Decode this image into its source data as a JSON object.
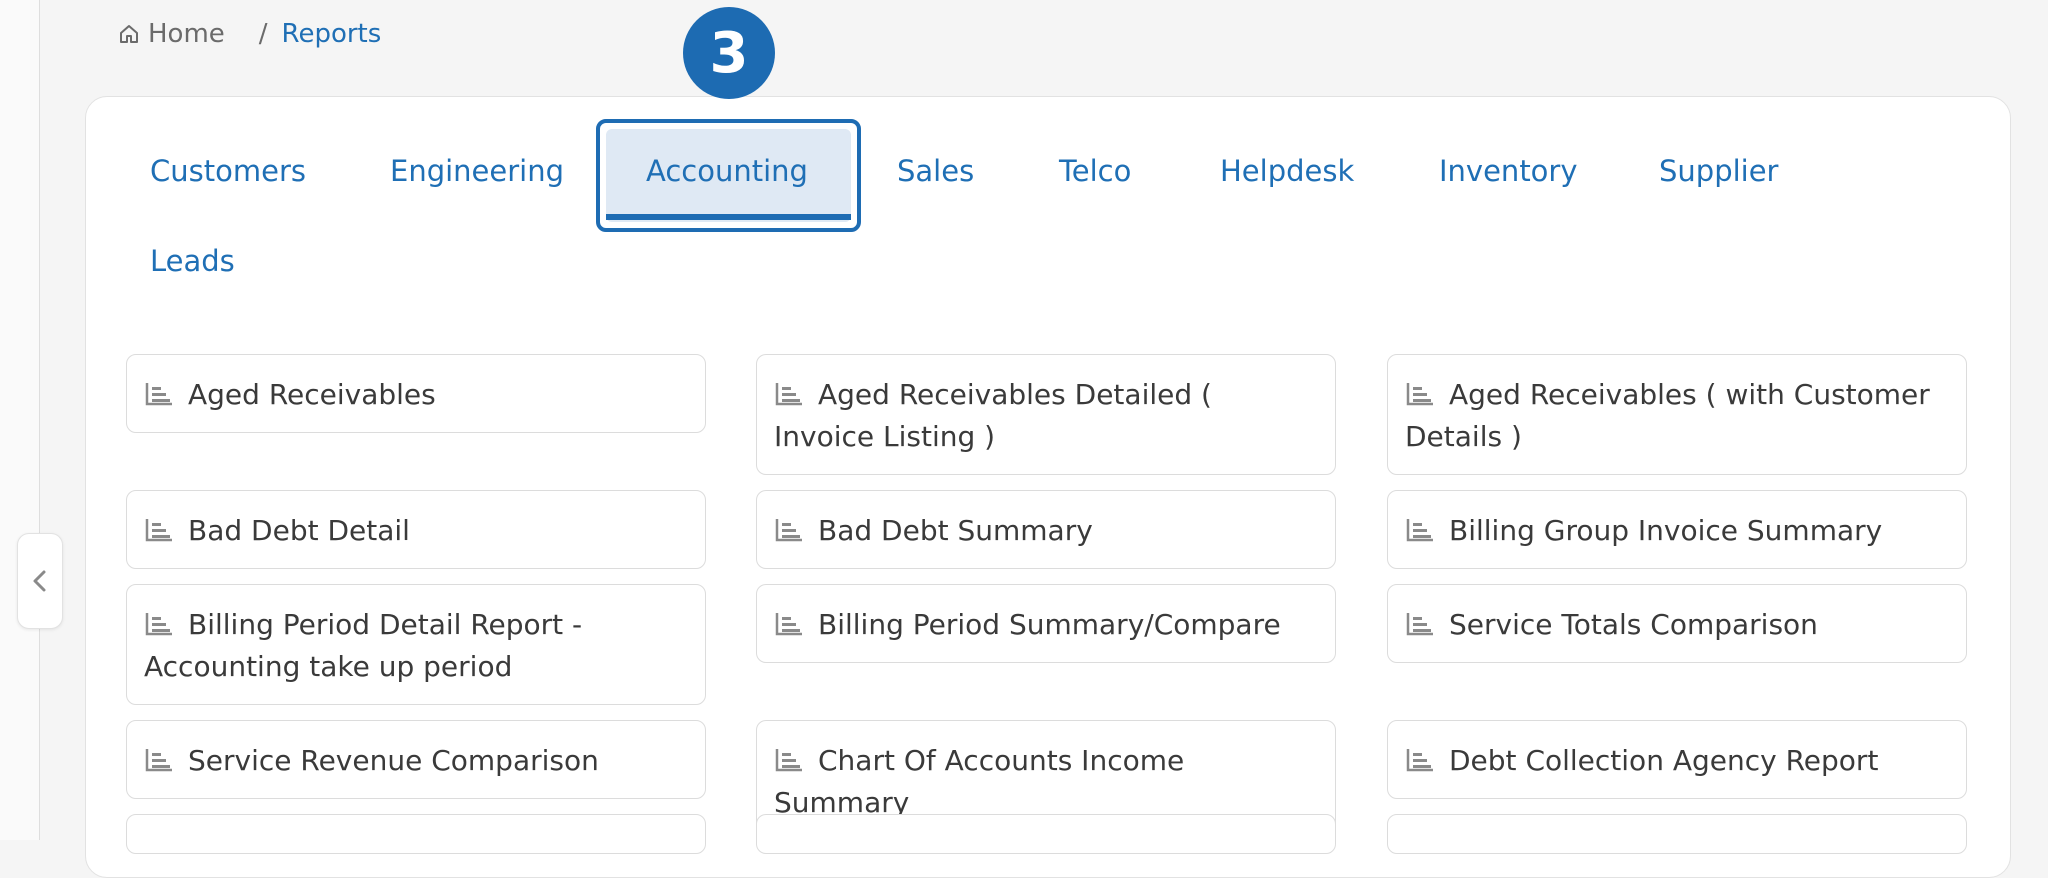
{
  "breadcrumb": {
    "home": "Home",
    "separator": "/",
    "current": "Reports"
  },
  "step_badge": "3",
  "tabs": [
    {
      "label": "Customers"
    },
    {
      "label": "Engineering"
    },
    {
      "label": "Accounting",
      "active": true
    },
    {
      "label": "Sales"
    },
    {
      "label": "Telco"
    },
    {
      "label": "Helpdesk"
    },
    {
      "label": "Inventory"
    },
    {
      "label": "Supplier"
    },
    {
      "label": "Leads"
    }
  ],
  "reports": [
    {
      "label": "Aged Receivables"
    },
    {
      "label": "Aged Receivables Detailed ( Invoice Listing )"
    },
    {
      "label": "Aged Receivables ( with Customer Details )"
    },
    {
      "label": "Bad Debt Detail"
    },
    {
      "label": "Bad Debt Summary"
    },
    {
      "label": "Billing Group Invoice Summary"
    },
    {
      "label": "Billing Period Detail Report - Accounting take up period"
    },
    {
      "label": "Billing Period Summary/Compare"
    },
    {
      "label": "Service Totals Comparison"
    },
    {
      "label": "Service Revenue Comparison"
    },
    {
      "label": "Chart Of Accounts Income Summary"
    },
    {
      "label": "Debt Collection Agency Report"
    }
  ],
  "icons": {
    "home": "home-icon",
    "report": "bar-chart-icon",
    "collapse": "chevron-left-icon"
  },
  "colors": {
    "accent": "#1f6fb5",
    "active_tab_bg": "#dfe9f4",
    "badge": "#1d6bb2"
  }
}
